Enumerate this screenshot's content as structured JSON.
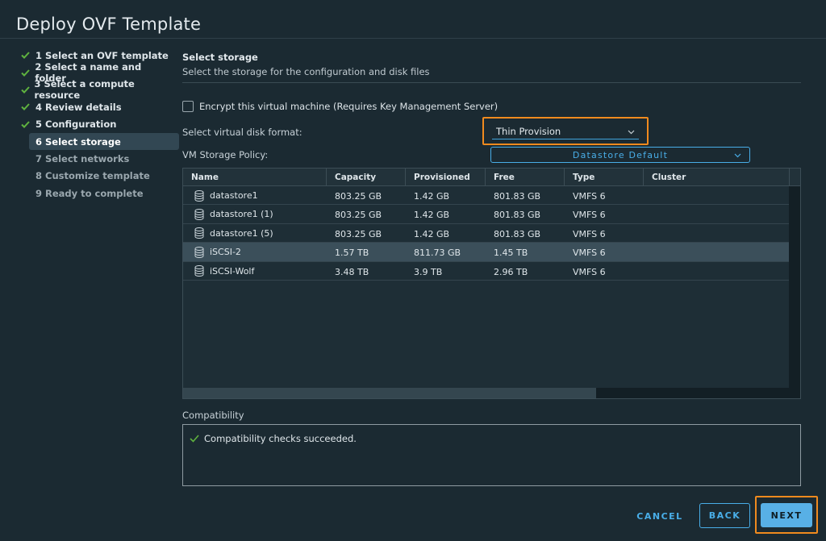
{
  "window": {
    "title": "Deploy OVF Template"
  },
  "steps": [
    {
      "label": "1 Select an OVF template",
      "status": "done"
    },
    {
      "label": "2 Select a name and folder",
      "status": "done"
    },
    {
      "label": "3 Select a compute resource",
      "status": "done"
    },
    {
      "label": "4 Review details",
      "status": "done"
    },
    {
      "label": "5 Configuration",
      "status": "done"
    },
    {
      "label": "6 Select storage",
      "status": "active"
    },
    {
      "label": "7 Select networks",
      "status": "pending"
    },
    {
      "label": "8 Customize template",
      "status": "pending"
    },
    {
      "label": "9 Ready to complete",
      "status": "pending"
    }
  ],
  "section": {
    "title": "Select storage",
    "subtitle": "Select the storage for the configuration and disk files"
  },
  "encrypt": {
    "label": "Encrypt this virtual machine (Requires Key Management Server)",
    "checked": false
  },
  "disk_format": {
    "label": "Select virtual disk format:",
    "value": "Thin Provision"
  },
  "storage_policy": {
    "label": "VM Storage Policy:",
    "value": "Datastore Default"
  },
  "table": {
    "columns": [
      "Name",
      "Capacity",
      "Provisioned",
      "Free",
      "Type",
      "Cluster"
    ],
    "rows": [
      {
        "name": "datastore1",
        "capacity": "803.25 GB",
        "provisioned": "1.42 GB",
        "free": "801.83 GB",
        "type": "VMFS 6",
        "cluster": ""
      },
      {
        "name": "datastore1 (1)",
        "capacity": "803.25 GB",
        "provisioned": "1.42 GB",
        "free": "801.83 GB",
        "type": "VMFS 6",
        "cluster": ""
      },
      {
        "name": "datastore1 (5)",
        "capacity": "803.25 GB",
        "provisioned": "1.42 GB",
        "free": "801.83 GB",
        "type": "VMFS 6",
        "cluster": ""
      },
      {
        "name": "iSCSI-2",
        "capacity": "1.57 TB",
        "provisioned": "811.73 GB",
        "free": "1.45 TB",
        "type": "VMFS 6",
        "cluster": "",
        "selected": true
      },
      {
        "name": "iSCSI-Wolf",
        "capacity": "3.48 TB",
        "provisioned": "3.9 TB",
        "free": "2.96 TB",
        "type": "VMFS 6",
        "cluster": ""
      }
    ]
  },
  "compatibility": {
    "label": "Compatibility",
    "message": "Compatibility checks succeeded."
  },
  "buttons": {
    "cancel": "CANCEL",
    "back": "BACK",
    "next": "NEXT"
  },
  "colors": {
    "accent": "#49aee8",
    "highlight": "#f08a1e",
    "success": "#5fb23f"
  },
  "icons": {
    "done_step": "check-icon",
    "datastore": "database-icon",
    "dropdown": "chevron-down-icon"
  }
}
